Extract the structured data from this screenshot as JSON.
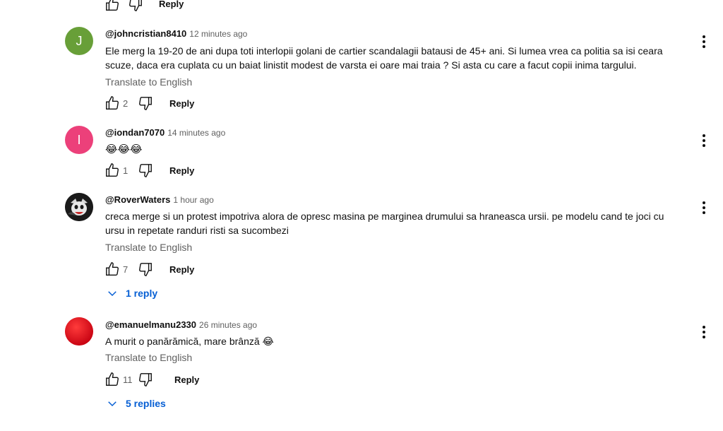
{
  "top_partial": {
    "reply_label": "Reply"
  },
  "comments": [
    {
      "author": "@johncristian8410",
      "time": "12 minutes ago",
      "avatar_letter": "J",
      "avatar_color": "#689f38",
      "text": "Ele merg la 19-20 de ani dupa toti interlopii golani de cartier scandalagii batausi de 45+ ani. Si lumea vrea ca politia sa isi ceara scuze, daca era cuplata cu un baiat linistit modest de varsta ei oare mai traia ? Si asta cu care a facut copii inima targului.",
      "translate": "Translate to English",
      "likes": "2",
      "reply_label": "Reply"
    },
    {
      "author": "@iondan7070",
      "time": "14 minutes ago",
      "avatar_letter": "I",
      "avatar_color": "#ec407a",
      "text": "😂😂😂",
      "likes": "1",
      "reply_label": "Reply"
    },
    {
      "author": "@RoverWaters",
      "time": "1 hour ago",
      "avatar_letter": "",
      "avatar_color": "#1a1a1a",
      "text": "creca merge si un  protest impotriva alora de opresc masina pe marginea drumului sa hraneasca ursii. pe modelu cand te joci cu ursu in repetate randuri risti sa sucombezi",
      "translate": "Translate to English",
      "likes": "7",
      "reply_label": "Reply",
      "replies": "1 reply"
    },
    {
      "author": "@emanuelmanu2330",
      "time": "26 minutes ago",
      "avatar_letter": "",
      "avatar_color": "#e50914",
      "text": "A murit o panărămică, mare brânză 😂",
      "translate": "Translate to English",
      "likes": "11",
      "reply_label": "Reply",
      "replies": "5 replies"
    }
  ],
  "icons": {
    "like": "thumb-up-icon",
    "dislike": "thumb-down-icon",
    "menu": "more-vert-icon",
    "expand": "chevron-down-icon"
  },
  "colors": {
    "link": "#065fd4",
    "secondary": "#606060"
  }
}
